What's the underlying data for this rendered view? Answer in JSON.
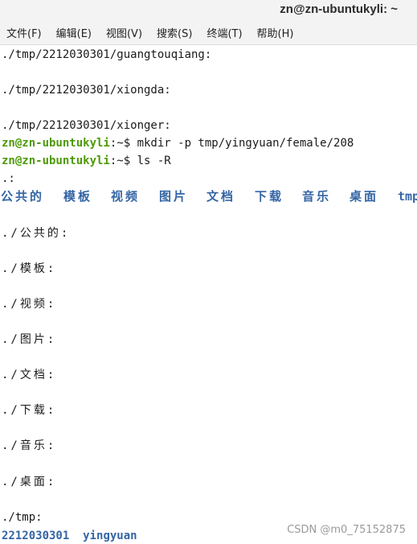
{
  "window": {
    "title": "zn@zn-ubuntukyli: ~"
  },
  "menu": [
    "文件(F)",
    "编辑(E)",
    "视图(V)",
    "搜索(S)",
    "终端(T)",
    "帮助(H)"
  ],
  "terminal": {
    "line1": "./tmp/2212030301/guangtouqiang:",
    "line2": "./tmp/2212030301/xiongda:",
    "line3": "./tmp/2212030301/xionger:",
    "prompt_user": "zn@zn-ubuntukyli",
    "prompt_path": ":~",
    "cmd1": "$ mkdir -p tmp/yingyuan/female/208",
    "cmd2": "$ ls -R",
    "dot": ".:",
    "dirs": [
      "公共的",
      "模板",
      "视频",
      "图片",
      "文档",
      "下载",
      "音乐",
      "桌面",
      "tmp"
    ],
    "sections": [
      "./公共的:",
      "./模板:",
      "./视频:",
      "./图片:",
      "./文档:",
      "./下载:",
      "./音乐:",
      "./桌面:"
    ],
    "tmp_header": "./tmp:",
    "tmp_items": [
      "2212030301",
      "yingyuan"
    ]
  },
  "watermark": "CSDN @m0_75152875",
  "colors": {
    "prompt_user": "#4e9a06",
    "directory": "#3465a4",
    "text": "#1a1a1a"
  }
}
